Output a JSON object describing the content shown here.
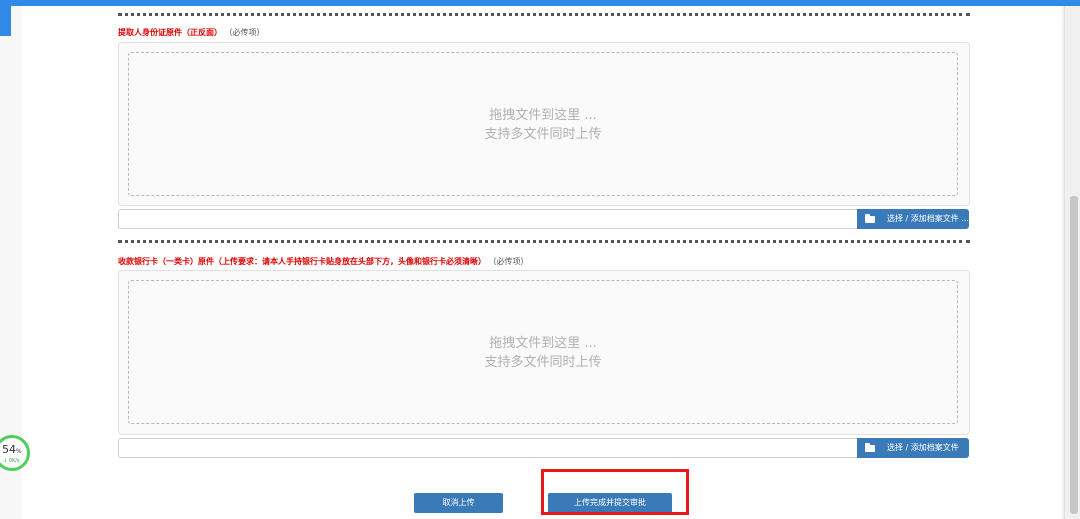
{
  "sections": [
    {
      "label_required": "提取人身份证原件（正反面）",
      "label_note": "（必传项）",
      "drop_line1": "拖拽文件到这里 ...",
      "drop_line2": "支持多文件同时上传",
      "browse_label": "选择 / 添加档案文件 ..."
    },
    {
      "label_required": "收款银行卡（一类卡）原件（上传要求：请本人手持银行卡贴身放在头部下方，头像和银行卡必须清晰）",
      "label_note": "（必传项）",
      "drop_line1": "拖拽文件到这里 ...",
      "drop_line2": "支持多文件同时上传",
      "browse_label": "选择 / 添加档案文件"
    }
  ],
  "actions": {
    "cancel_label": "取消上传",
    "submit_label": "上传完成并提交审批"
  },
  "speed_widget": {
    "percent": "54",
    "percent_unit": "%",
    "rate": "↓ 0K/s"
  },
  "colors": {
    "accent": "#3a7ab8",
    "required_text": "#e00000",
    "highlight": "#e51919",
    "top_bar": "#2f8be6"
  }
}
